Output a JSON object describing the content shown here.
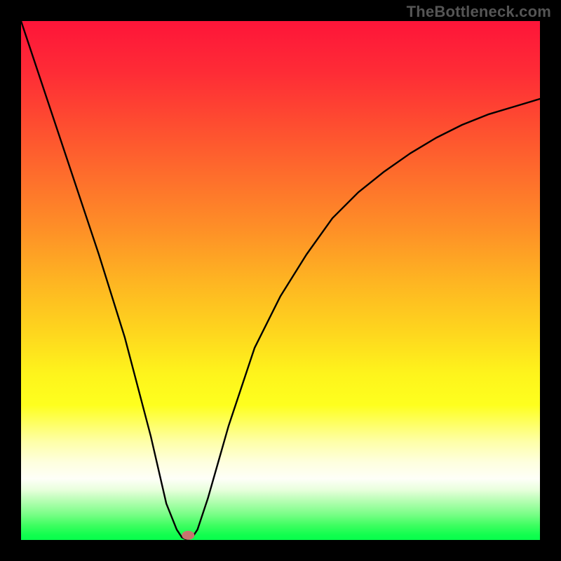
{
  "watermark": "TheBottleneck.com",
  "chart_data": {
    "type": "line",
    "title": "",
    "xlabel": "",
    "ylabel": "",
    "xlim": [
      0,
      100
    ],
    "ylim": [
      0,
      100
    ],
    "x": [
      0,
      5,
      10,
      15,
      20,
      25,
      28,
      30,
      31,
      32,
      33,
      34,
      36,
      38,
      40,
      45,
      50,
      55,
      60,
      65,
      70,
      75,
      80,
      85,
      90,
      95,
      100
    ],
    "values": [
      100,
      85,
      70,
      55,
      39,
      20,
      7,
      2,
      0.5,
      0,
      0.5,
      2,
      8,
      15,
      22,
      37,
      47,
      55,
      62,
      67,
      71,
      74.5,
      77.5,
      80,
      82,
      83.5,
      85
    ],
    "min_x": 32,
    "min_marker": {
      "x": 32.2,
      "y": 0.9
    },
    "gradient_stops": [
      {
        "offset": 0.0,
        "color": "#fe1539"
      },
      {
        "offset": 0.1,
        "color": "#fe2c36"
      },
      {
        "offset": 0.2,
        "color": "#fe4d30"
      },
      {
        "offset": 0.3,
        "color": "#fe6e2c"
      },
      {
        "offset": 0.4,
        "color": "#fe8f27"
      },
      {
        "offset": 0.5,
        "color": "#feb422"
      },
      {
        "offset": 0.6,
        "color": "#fed61e"
      },
      {
        "offset": 0.68,
        "color": "#fef41c"
      },
      {
        "offset": 0.74,
        "color": "#feff1e"
      },
      {
        "offset": 0.81,
        "color": "#feffa7"
      },
      {
        "offset": 0.85,
        "color": "#feffde"
      },
      {
        "offset": 0.882,
        "color": "#fefff8"
      },
      {
        "offset": 0.903,
        "color": "#e9ffdd"
      },
      {
        "offset": 0.925,
        "color": "#b5feb2"
      },
      {
        "offset": 0.951,
        "color": "#78fe86"
      },
      {
        "offset": 0.972,
        "color": "#3dfe60"
      },
      {
        "offset": 0.99,
        "color": "#12fe4f"
      },
      {
        "offset": 1.0,
        "color": "#07fe4c"
      }
    ]
  }
}
